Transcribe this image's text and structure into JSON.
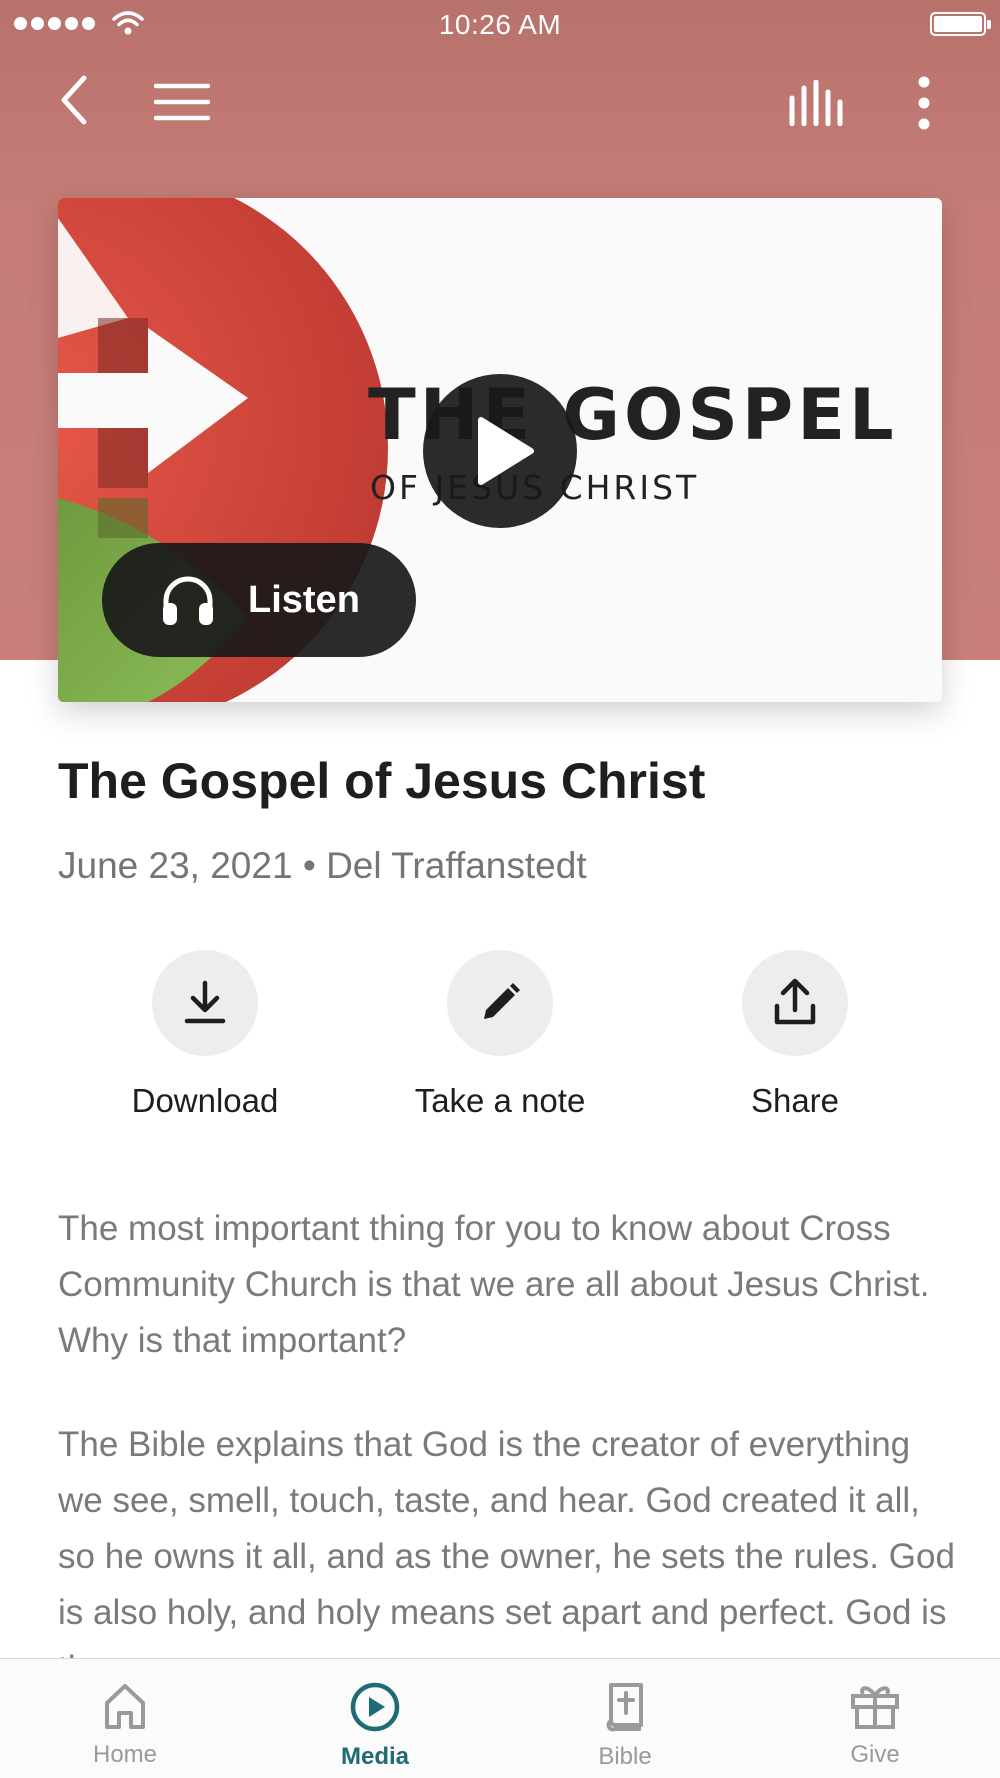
{
  "status_bar": {
    "time": "10:26 AM"
  },
  "artwork": {
    "title": "THE GOSPEL",
    "subtitle": "OF JESUS CHRIST"
  },
  "listen_label": "Listen",
  "title": "The Gospel of Jesus Christ",
  "meta": {
    "date": "June 23, 2021",
    "separator": "•",
    "speaker": "Del Traffanstedt"
  },
  "actions": [
    {
      "label": "Download",
      "icon": "download-icon"
    },
    {
      "label": "Take a note",
      "icon": "pencil-icon"
    },
    {
      "label": "Share",
      "icon": "share-icon"
    }
  ],
  "description": [
    "The most important thing for you to know about Cross Community Church is that we are all about Jesus Christ. Why is that important?",
    "The Bible explains that God is the creator of everything we see, smell, touch, taste, and hear. God created it all, so he owns it all, and as the owner, he sets the rules. God is also holy, and holy means set apart and perfect. God is the very"
  ],
  "tabs": [
    {
      "label": "Home",
      "icon": "home-icon",
      "active": false
    },
    {
      "label": "Media",
      "icon": "play-circle-icon",
      "active": true
    },
    {
      "label": "Bible",
      "icon": "bible-icon",
      "active": false
    },
    {
      "label": "Give",
      "icon": "gift-icon",
      "active": false
    }
  ],
  "colors": {
    "header_bg": "#c67d77",
    "active_tab": "#1e6b73",
    "inactive_tab": "#9a9a9a",
    "logo_red": "#d9493e",
    "logo_green": "#7fae4e"
  }
}
